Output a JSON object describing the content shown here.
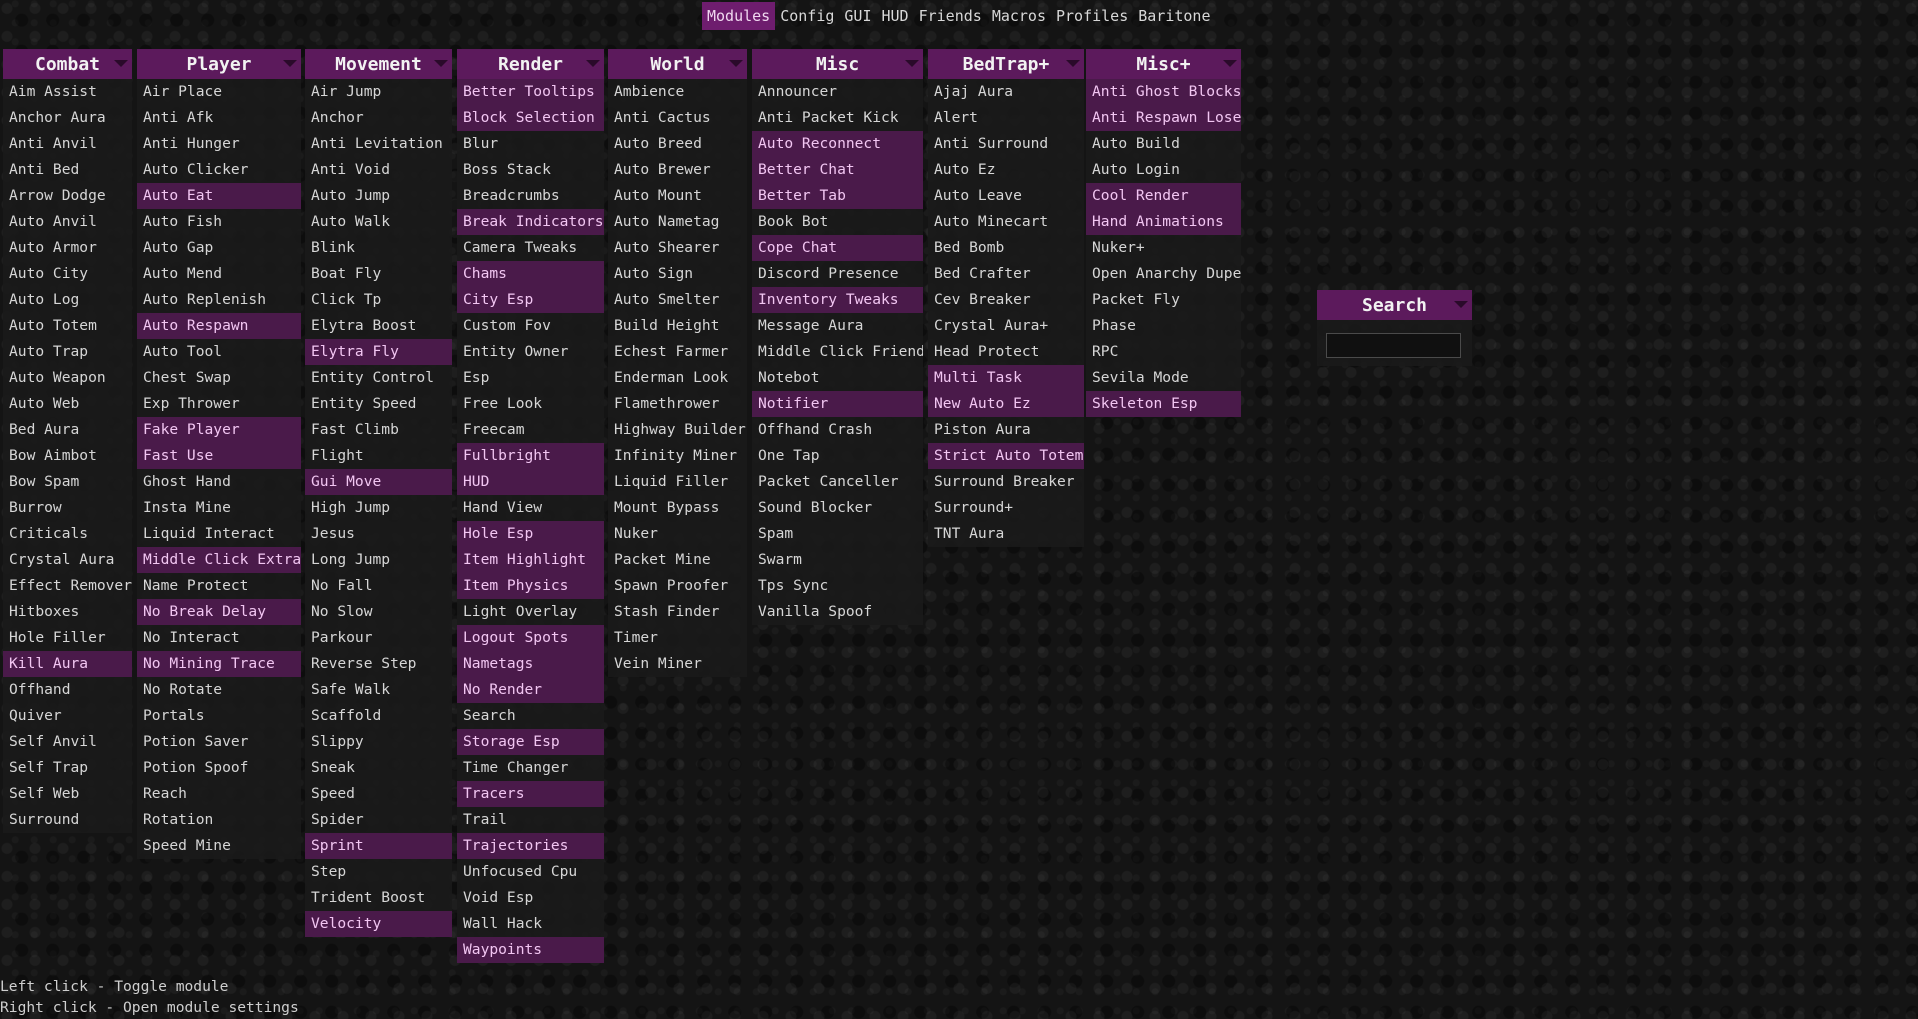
{
  "tabs": [
    "Modules",
    "Config",
    "GUI",
    "HUD",
    "Friends",
    "Macros",
    "Profiles",
    "Baritone"
  ],
  "active_tab": "Modules",
  "colors": {
    "accent": "#6e1d6e",
    "header": "#5c1a5c",
    "enabled_bg": "#4a1a4a",
    "enabled_text": "#f2c6f2"
  },
  "panels": [
    {
      "title": "Combat",
      "modules": [
        {
          "name": "Aim Assist",
          "on": false
        },
        {
          "name": "Anchor Aura",
          "on": false
        },
        {
          "name": "Anti Anvil",
          "on": false
        },
        {
          "name": "Anti Bed",
          "on": false
        },
        {
          "name": "Arrow Dodge",
          "on": false
        },
        {
          "name": "Auto Anvil",
          "on": false
        },
        {
          "name": "Auto Armor",
          "on": false
        },
        {
          "name": "Auto City",
          "on": false
        },
        {
          "name": "Auto Log",
          "on": false
        },
        {
          "name": "Auto Totem",
          "on": false
        },
        {
          "name": "Auto Trap",
          "on": false
        },
        {
          "name": "Auto Weapon",
          "on": false
        },
        {
          "name": "Auto Web",
          "on": false
        },
        {
          "name": "Bed Aura",
          "on": false
        },
        {
          "name": "Bow Aimbot",
          "on": false
        },
        {
          "name": "Bow Spam",
          "on": false
        },
        {
          "name": "Burrow",
          "on": false
        },
        {
          "name": "Criticals",
          "on": false
        },
        {
          "name": "Crystal Aura",
          "on": false
        },
        {
          "name": "Effect Remover",
          "on": false
        },
        {
          "name": "Hitboxes",
          "on": false
        },
        {
          "name": "Hole Filler",
          "on": false
        },
        {
          "name": "Kill Aura",
          "on": true
        },
        {
          "name": "Offhand",
          "on": false
        },
        {
          "name": "Quiver",
          "on": false
        },
        {
          "name": "Self Anvil",
          "on": false
        },
        {
          "name": "Self Trap",
          "on": false
        },
        {
          "name": "Self Web",
          "on": false
        },
        {
          "name": "Surround",
          "on": false
        }
      ]
    },
    {
      "title": "Player",
      "modules": [
        {
          "name": "Air Place",
          "on": false
        },
        {
          "name": "Anti Afk",
          "on": false
        },
        {
          "name": "Anti Hunger",
          "on": false
        },
        {
          "name": "Auto Clicker",
          "on": false
        },
        {
          "name": "Auto Eat",
          "on": true
        },
        {
          "name": "Auto Fish",
          "on": false
        },
        {
          "name": "Auto Gap",
          "on": false
        },
        {
          "name": "Auto Mend",
          "on": false
        },
        {
          "name": "Auto Replenish",
          "on": false
        },
        {
          "name": "Auto Respawn",
          "on": true
        },
        {
          "name": "Auto Tool",
          "on": false
        },
        {
          "name": "Chest Swap",
          "on": false
        },
        {
          "name": "Exp Thrower",
          "on": false
        },
        {
          "name": "Fake Player",
          "on": true
        },
        {
          "name": "Fast Use",
          "on": true
        },
        {
          "name": "Ghost Hand",
          "on": false
        },
        {
          "name": "Insta Mine",
          "on": false
        },
        {
          "name": "Liquid Interact",
          "on": false
        },
        {
          "name": "Middle Click Extra",
          "on": true
        },
        {
          "name": "Name Protect",
          "on": false
        },
        {
          "name": "No Break Delay",
          "on": true
        },
        {
          "name": "No Interact",
          "on": false
        },
        {
          "name": "No Mining Trace",
          "on": true
        },
        {
          "name": "No Rotate",
          "on": false
        },
        {
          "name": "Portals",
          "on": false
        },
        {
          "name": "Potion Saver",
          "on": false
        },
        {
          "name": "Potion Spoof",
          "on": false
        },
        {
          "name": "Reach",
          "on": false
        },
        {
          "name": "Rotation",
          "on": false
        },
        {
          "name": "Speed Mine",
          "on": false
        }
      ]
    },
    {
      "title": "Movement",
      "modules": [
        {
          "name": "Air Jump",
          "on": false
        },
        {
          "name": "Anchor",
          "on": false
        },
        {
          "name": "Anti Levitation",
          "on": false
        },
        {
          "name": "Anti Void",
          "on": false
        },
        {
          "name": "Auto Jump",
          "on": false
        },
        {
          "name": "Auto Walk",
          "on": false
        },
        {
          "name": "Blink",
          "on": false
        },
        {
          "name": "Boat Fly",
          "on": false
        },
        {
          "name": "Click Tp",
          "on": false
        },
        {
          "name": "Elytra Boost",
          "on": false
        },
        {
          "name": "Elytra Fly",
          "on": true
        },
        {
          "name": "Entity Control",
          "on": false
        },
        {
          "name": "Entity Speed",
          "on": false
        },
        {
          "name": "Fast Climb",
          "on": false
        },
        {
          "name": "Flight",
          "on": false
        },
        {
          "name": "Gui Move",
          "on": true
        },
        {
          "name": "High Jump",
          "on": false
        },
        {
          "name": "Jesus",
          "on": false
        },
        {
          "name": "Long Jump",
          "on": false
        },
        {
          "name": "No Fall",
          "on": false
        },
        {
          "name": "No Slow",
          "on": false
        },
        {
          "name": "Parkour",
          "on": false
        },
        {
          "name": "Reverse Step",
          "on": false
        },
        {
          "name": "Safe Walk",
          "on": false
        },
        {
          "name": "Scaffold",
          "on": false
        },
        {
          "name": "Slippy",
          "on": false
        },
        {
          "name": "Sneak",
          "on": false
        },
        {
          "name": "Speed",
          "on": false
        },
        {
          "name": "Spider",
          "on": false
        },
        {
          "name": "Sprint",
          "on": true
        },
        {
          "name": "Step",
          "on": false
        },
        {
          "name": "Trident Boost",
          "on": false
        },
        {
          "name": "Velocity",
          "on": true
        }
      ]
    },
    {
      "title": "Render",
      "modules": [
        {
          "name": "Better Tooltips",
          "on": true
        },
        {
          "name": "Block Selection",
          "on": true
        },
        {
          "name": "Blur",
          "on": false
        },
        {
          "name": "Boss Stack",
          "on": false
        },
        {
          "name": "Breadcrumbs",
          "on": false
        },
        {
          "name": "Break Indicators",
          "on": true
        },
        {
          "name": "Camera Tweaks",
          "on": false
        },
        {
          "name": "Chams",
          "on": true
        },
        {
          "name": "City Esp",
          "on": true
        },
        {
          "name": "Custom Fov",
          "on": false
        },
        {
          "name": "Entity Owner",
          "on": false
        },
        {
          "name": "Esp",
          "on": false
        },
        {
          "name": "Free Look",
          "on": false
        },
        {
          "name": "Freecam",
          "on": false
        },
        {
          "name": "Fullbright",
          "on": true
        },
        {
          "name": "HUD",
          "on": true
        },
        {
          "name": "Hand View",
          "on": false
        },
        {
          "name": "Hole Esp",
          "on": true
        },
        {
          "name": "Item Highlight",
          "on": true
        },
        {
          "name": "Item Physics",
          "on": true
        },
        {
          "name": "Light Overlay",
          "on": false
        },
        {
          "name": "Logout Spots",
          "on": true
        },
        {
          "name": "Nametags",
          "on": true
        },
        {
          "name": "No Render",
          "on": true
        },
        {
          "name": "Search",
          "on": false
        },
        {
          "name": "Storage Esp",
          "on": true
        },
        {
          "name": "Time Changer",
          "on": false
        },
        {
          "name": "Tracers",
          "on": true
        },
        {
          "name": "Trail",
          "on": false
        },
        {
          "name": "Trajectories",
          "on": true
        },
        {
          "name": "Unfocused Cpu",
          "on": false
        },
        {
          "name": "Void Esp",
          "on": false
        },
        {
          "name": "Wall Hack",
          "on": false
        },
        {
          "name": "Waypoints",
          "on": true
        }
      ]
    },
    {
      "title": "World",
      "modules": [
        {
          "name": "Ambience",
          "on": false
        },
        {
          "name": "Anti Cactus",
          "on": false
        },
        {
          "name": "Auto Breed",
          "on": false
        },
        {
          "name": "Auto Brewer",
          "on": false
        },
        {
          "name": "Auto Mount",
          "on": false
        },
        {
          "name": "Auto Nametag",
          "on": false
        },
        {
          "name": "Auto Shearer",
          "on": false
        },
        {
          "name": "Auto Sign",
          "on": false
        },
        {
          "name": "Auto Smelter",
          "on": false
        },
        {
          "name": "Build Height",
          "on": false
        },
        {
          "name": "Echest Farmer",
          "on": false
        },
        {
          "name": "Enderman Look",
          "on": false
        },
        {
          "name": "Flamethrower",
          "on": false
        },
        {
          "name": "Highway Builder",
          "on": false
        },
        {
          "name": "Infinity Miner",
          "on": false
        },
        {
          "name": "Liquid Filler",
          "on": false
        },
        {
          "name": "Mount Bypass",
          "on": false
        },
        {
          "name": "Nuker",
          "on": false
        },
        {
          "name": "Packet Mine",
          "on": false
        },
        {
          "name": "Spawn Proofer",
          "on": false
        },
        {
          "name": "Stash Finder",
          "on": false
        },
        {
          "name": "Timer",
          "on": false
        },
        {
          "name": "Vein Miner",
          "on": false
        }
      ]
    },
    {
      "title": "Misc",
      "modules": [
        {
          "name": "Announcer",
          "on": false
        },
        {
          "name": "Anti Packet Kick",
          "on": false
        },
        {
          "name": "Auto Reconnect",
          "on": true
        },
        {
          "name": "Better Chat",
          "on": true
        },
        {
          "name": "Better Tab",
          "on": true
        },
        {
          "name": "Book Bot",
          "on": false
        },
        {
          "name": "Cope Chat",
          "on": true
        },
        {
          "name": "Discord Presence",
          "on": false
        },
        {
          "name": "Inventory Tweaks",
          "on": true
        },
        {
          "name": "Message Aura",
          "on": false
        },
        {
          "name": "Middle Click Friend",
          "on": false
        },
        {
          "name": "Notebot",
          "on": false
        },
        {
          "name": "Notifier",
          "on": true
        },
        {
          "name": "Offhand Crash",
          "on": false
        },
        {
          "name": "One Tap",
          "on": false
        },
        {
          "name": "Packet Canceller",
          "on": false
        },
        {
          "name": "Sound Blocker",
          "on": false
        },
        {
          "name": "Spam",
          "on": false
        },
        {
          "name": "Swarm",
          "on": false
        },
        {
          "name": "Tps Sync",
          "on": false
        },
        {
          "name": "Vanilla Spoof",
          "on": false
        }
      ]
    },
    {
      "title": "BedTrap+",
      "modules": [
        {
          "name": "Ajaj Aura",
          "on": false
        },
        {
          "name": "Alert",
          "on": false
        },
        {
          "name": "Anti Surround",
          "on": false
        },
        {
          "name": "Auto Ez",
          "on": false
        },
        {
          "name": "Auto Leave",
          "on": false
        },
        {
          "name": "Auto Minecart",
          "on": false
        },
        {
          "name": "Bed Bomb",
          "on": false
        },
        {
          "name": "Bed Crafter",
          "on": false
        },
        {
          "name": "Cev Breaker",
          "on": false
        },
        {
          "name": "Crystal Aura+",
          "on": false
        },
        {
          "name": "Head Protect",
          "on": false
        },
        {
          "name": "Multi Task",
          "on": true
        },
        {
          "name": "New Auto Ez",
          "on": true
        },
        {
          "name": "Piston Aura",
          "on": false
        },
        {
          "name": "Strict Auto Totem",
          "on": true
        },
        {
          "name": "Surround Breaker",
          "on": false
        },
        {
          "name": "Surround+",
          "on": false
        },
        {
          "name": "TNT Aura",
          "on": false
        }
      ]
    },
    {
      "title": "Misc+",
      "modules": [
        {
          "name": "Anti Ghost Blocks",
          "on": true
        },
        {
          "name": "Anti Respawn Lose",
          "on": true
        },
        {
          "name": "Auto Build",
          "on": false
        },
        {
          "name": "Auto Login",
          "on": false
        },
        {
          "name": "Cool Render",
          "on": true
        },
        {
          "name": "Hand Animations",
          "on": true
        },
        {
          "name": "Nuker+",
          "on": false
        },
        {
          "name": "Open Anarchy Dupe",
          "on": false
        },
        {
          "name": "Packet Fly",
          "on": false
        },
        {
          "name": "Phase",
          "on": false
        },
        {
          "name": "RPC",
          "on": false
        },
        {
          "name": "Sevila Mode",
          "on": false
        },
        {
          "name": "Skeleton Esp",
          "on": true
        }
      ]
    }
  ],
  "search": {
    "title": "Search",
    "value": ""
  },
  "hints": [
    "Left click - Toggle module",
    "Right click - Open module settings"
  ]
}
